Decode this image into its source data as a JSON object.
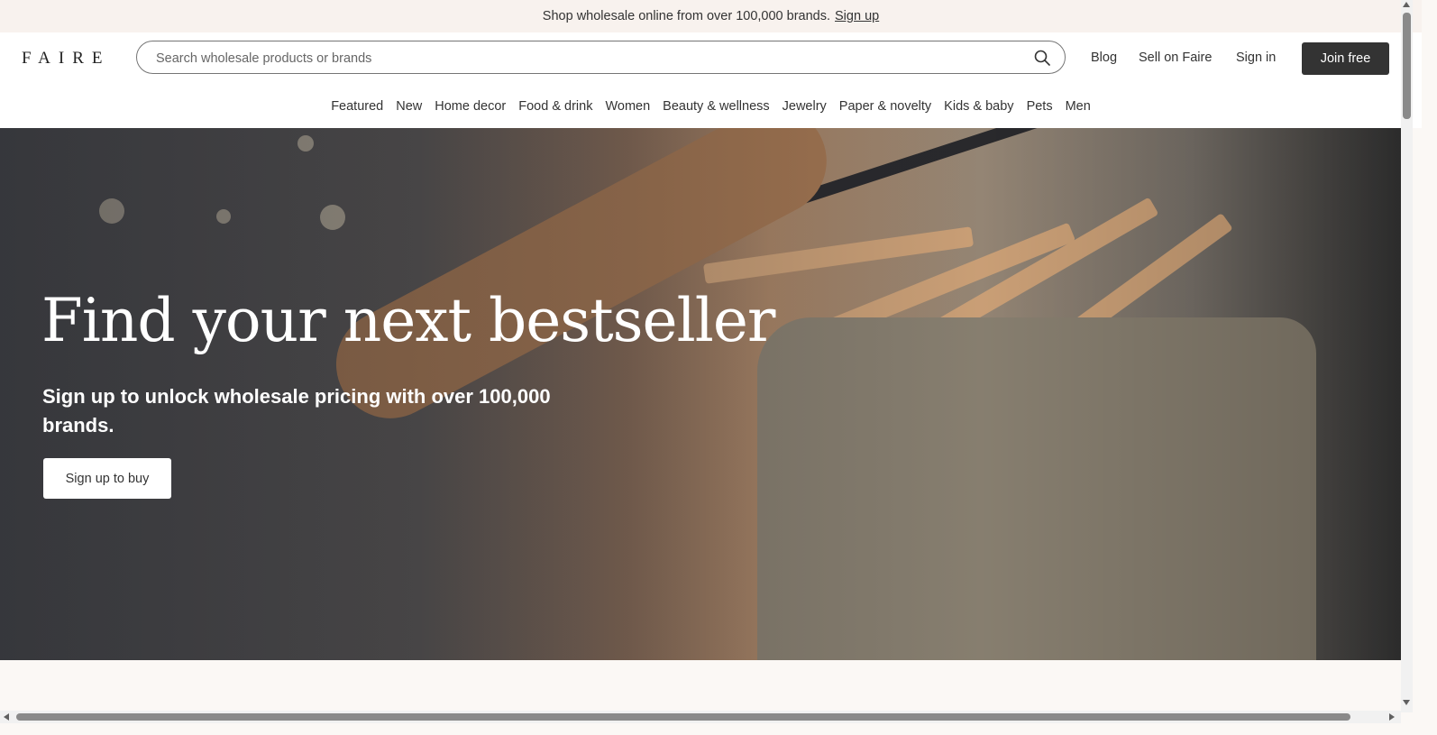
{
  "banner": {
    "text": "Shop wholesale online from over 100,000 brands.",
    "link": "Sign up"
  },
  "header": {
    "logo": "FAIRE",
    "search_placeholder": "Search wholesale products or brands",
    "links": {
      "blog": "Blog",
      "sell": "Sell on Faire",
      "signin": "Sign in"
    },
    "join_button": "Join free"
  },
  "categories": [
    "Featured",
    "New",
    "Home decor",
    "Food & drink",
    "Women",
    "Beauty & wellness",
    "Jewelry",
    "Paper & novelty",
    "Kids & baby",
    "Pets",
    "Men"
  ],
  "hero": {
    "title": "Find your next bestseller",
    "subtitle": "Sign up to unlock wholesale pricing with over 100,000 brands.",
    "button": "Sign up to buy"
  },
  "icons": {
    "search": "search-icon"
  },
  "colors": {
    "banner_bg": "#f8f2ee",
    "join_bg": "#333333",
    "page_bg": "#fbf8f5"
  }
}
